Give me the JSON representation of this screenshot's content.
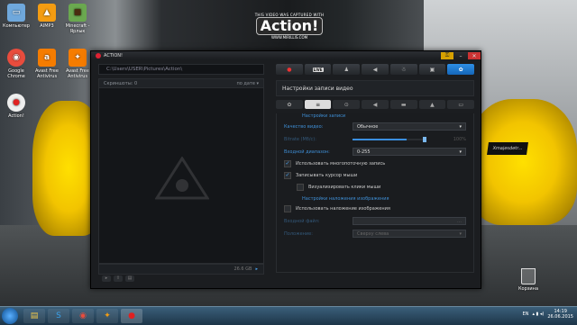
{
  "desktop": {
    "icons": [
      {
        "label": "Компьютер",
        "glyph": "▭",
        "color": "#6fa8dc"
      },
      {
        "label": "AIMP3",
        "glyph": "▲",
        "color": "#f39c12"
      },
      {
        "label": "Minecraft - Ярлык",
        "glyph": "■",
        "color": "#6aa84f"
      },
      {
        "label": "Google Chrome",
        "glyph": "◉",
        "color": "#e84c3d"
      },
      {
        "label": "Avast Free Antivirus",
        "glyph": "a",
        "color": "#f57c00"
      },
      {
        "label": "Avast Free Antivirus",
        "glyph": "✦",
        "color": "#f57c00"
      },
      {
        "label": "Action!",
        "glyph": "●",
        "color": "#e02020"
      }
    ],
    "trash_label": "Корзина",
    "car_decal": "Xmajesdetr..."
  },
  "watermark": {
    "top": "THIS VIDEO WAS CAPTURED WITH",
    "brand": "Action!",
    "site": "WWW.MIRILLIS.COM"
  },
  "window": {
    "title": "ACTION!",
    "path": "C:\\Users\\USER\\Pictures\\Action\\",
    "list_header_left": "Скриншоты: 0",
    "list_header_right": "по дате ▾",
    "free_space": "26.6 GB",
    "tabs": [
      "●",
      "LIVE",
      "♟",
      "◀",
      "☃",
      "▣",
      "✿"
    ],
    "settings_title": "Настройки записи видео",
    "sub_tabs": [
      "✿",
      "≡",
      "⊙",
      "◀",
      "▬",
      "▲",
      "▭"
    ],
    "section_record": "Настройки записи",
    "quality_label": "Качество видео:",
    "quality_value": "Обычное",
    "bitrate_label": "Bitrate (Мб/с):",
    "bitrate_percent": "100%",
    "bitrate_level": 0.75,
    "range_label": "Входной диапазон:",
    "range_value": "0-255",
    "chk_multithread": "Использовать многопоточную запись",
    "chk_cursor": "Записывать курсор мыши",
    "chk_clicks": "Визуализировать клики мыши",
    "section_overlay": "Настройки наложения изображения",
    "chk_overlay": "Использовать наложение изображения",
    "input_file_label": "Входной файл:",
    "position_label": "Положение:",
    "position_value": "Сверху слева"
  },
  "taskbar": {
    "lang": "EN",
    "time": "14:19",
    "date": "26.06.2015"
  }
}
